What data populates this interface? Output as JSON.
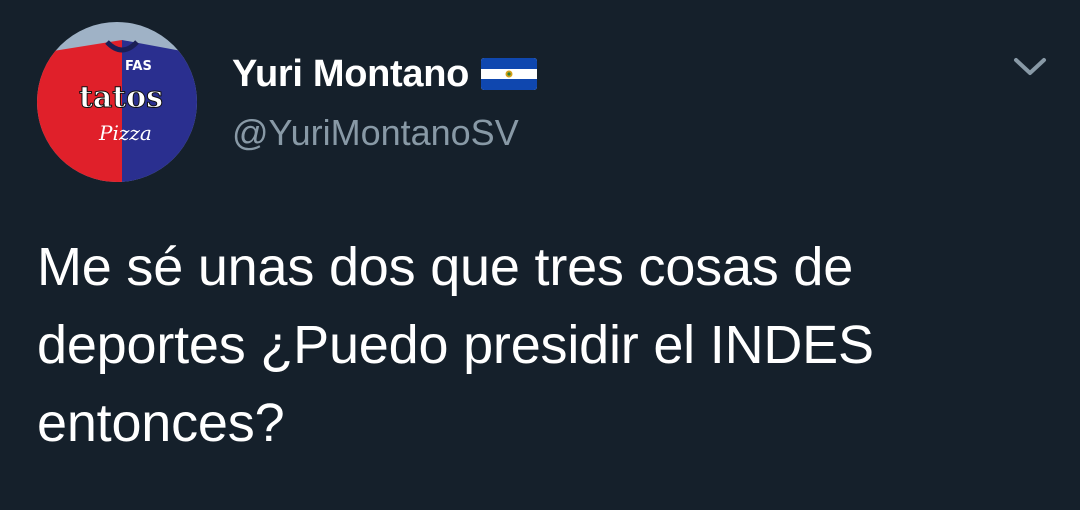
{
  "tweet": {
    "avatar": {
      "icon": "profile-avatar",
      "jersey_text": "tatos",
      "jersey_script": "Pizza",
      "jersey_badge": "FAS",
      "colors": {
        "left": "#e0202a",
        "right": "#2a2f8f"
      }
    },
    "author": {
      "display_name": "Yuri Montano",
      "flag_icon": "el-salvador-flag-icon",
      "handle": "@YuriMontanoSV"
    },
    "menu_icon": "chevron-down-icon",
    "text": "Me sé unas dos que tres cosas de deportes ¿Puedo presidir el INDES entonces?"
  },
  "colors": {
    "background": "#15202b",
    "primary_text": "#ffffff",
    "secondary_text": "#8899a6",
    "flag_blue": "#0f47af"
  }
}
